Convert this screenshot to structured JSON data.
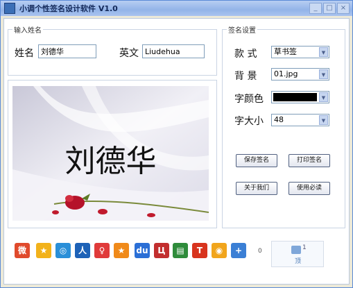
{
  "window": {
    "title": "小调个性签名设计软件 V1.0",
    "min": "_",
    "max": "□",
    "close": "×"
  },
  "input_group": {
    "legend": "输入姓名",
    "name_label": "姓名",
    "name_value": "刘德华",
    "en_label": "英文",
    "en_value": "Liudehua"
  },
  "settings": {
    "legend": "签名设置",
    "style_label": "款  式",
    "style_value": "草书签",
    "bg_label": "背  景",
    "bg_value": "01.jpg",
    "color_label": "字颜色",
    "color_value": "#000000",
    "size_label": "字大小",
    "size_value": "48"
  },
  "preview": {
    "signature": "刘德华"
  },
  "buttons": {
    "save": "保存签名",
    "print": "打印签名",
    "about": "关于我们",
    "help": "使用必读"
  },
  "share": {
    "icons": [
      "weibo-icon",
      "qzone-icon",
      "tencent-weibo-icon",
      "renren-icon",
      "kaixin-icon",
      "pengyou-icon",
      "baidu-icon",
      "douban-icon",
      "sina-blog-icon",
      "tianya-icon",
      "qq-icon",
      "more-icon"
    ],
    "count": "0",
    "like_count": "1",
    "like_label": "顶"
  }
}
